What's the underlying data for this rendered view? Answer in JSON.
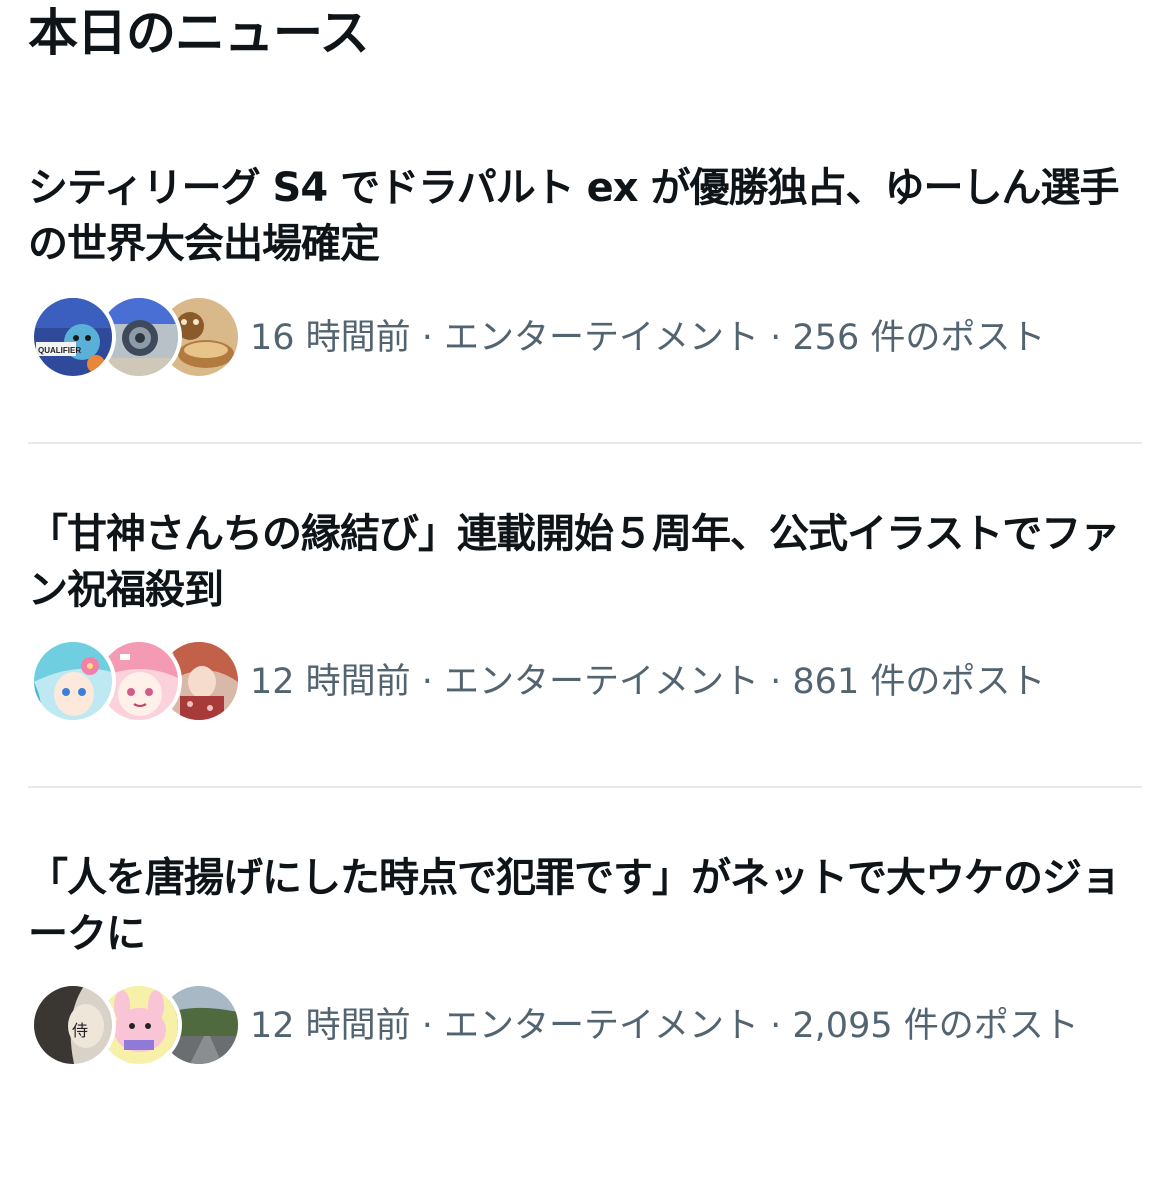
{
  "page_title": "本日のニュース",
  "news": [
    {
      "headline": "シティリーグ S4 でドラパルト ex が優勝独占、ゆーしん選手の世界大会出場確定",
      "meta": "16 時間前 · エンターテイメント · 256 件のポスト",
      "avatar_badge_text": "QUALIFIER"
    },
    {
      "headline": "「甘神さんちの縁結び」連載開始５周年、公式イラストでファン祝福殺到",
      "meta": "12 時間前 · エンターテイメント · 861 件のポスト"
    },
    {
      "headline": "「人を唐揚げにした時点で犯罪です」がネットで大ウケのジョークに",
      "meta": "12 時間前 · エンターテイメント · 2,095 件のポスト",
      "avatar_char": "侍"
    }
  ]
}
